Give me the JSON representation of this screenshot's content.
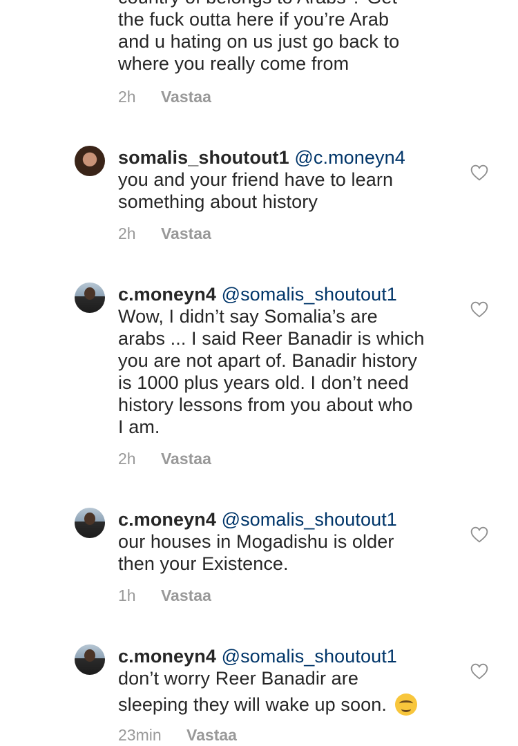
{
  "comments": [
    {
      "lines": [
        "country of belongs to Arabs ? Get",
        "the fuck outta here if you’re Arab",
        "and u hating on us just go back to",
        "where you really come from"
      ],
      "time": "2h",
      "reply_label": "Vastaa"
    },
    {
      "username": "somalis_shoutout1",
      "mention": "@c.moneyn4",
      "lines": [
        "you and your friend have to learn",
        "something about history"
      ],
      "time": "2h",
      "reply_label": "Vastaa"
    },
    {
      "username": "c.moneyn4",
      "mention": "@somalis_shoutout1",
      "lines": [
        "Wow, I didn’t say Somalia’s are",
        "arabs ... I said Reer Banadir is which",
        "you are not apart of. Banadir history",
        "is 1000 plus years old. I don’t need",
        "history lessons from you about who",
        "I am."
      ],
      "time": "2h",
      "reply_label": "Vastaa"
    },
    {
      "username": "c.moneyn4",
      "mention": "@somalis_shoutout1",
      "lines": [
        "our houses in Mogadishu is older",
        "then your Existence."
      ],
      "time": "1h",
      "reply_label": "Vastaa"
    },
    {
      "username": "c.moneyn4",
      "mention": "@somalis_shoutout1",
      "lines": [
        "don’t worry Reer Banadir are",
        "sleeping they will wake up soon."
      ],
      "emoji": "smiling-face-emoji",
      "time": "23min",
      "reply_label": "Vastaa"
    }
  ],
  "icons": {
    "heart": "heart-outline-icon"
  },
  "colors": {
    "username": "#262626",
    "mention": "#003569",
    "meta": "#999999"
  }
}
